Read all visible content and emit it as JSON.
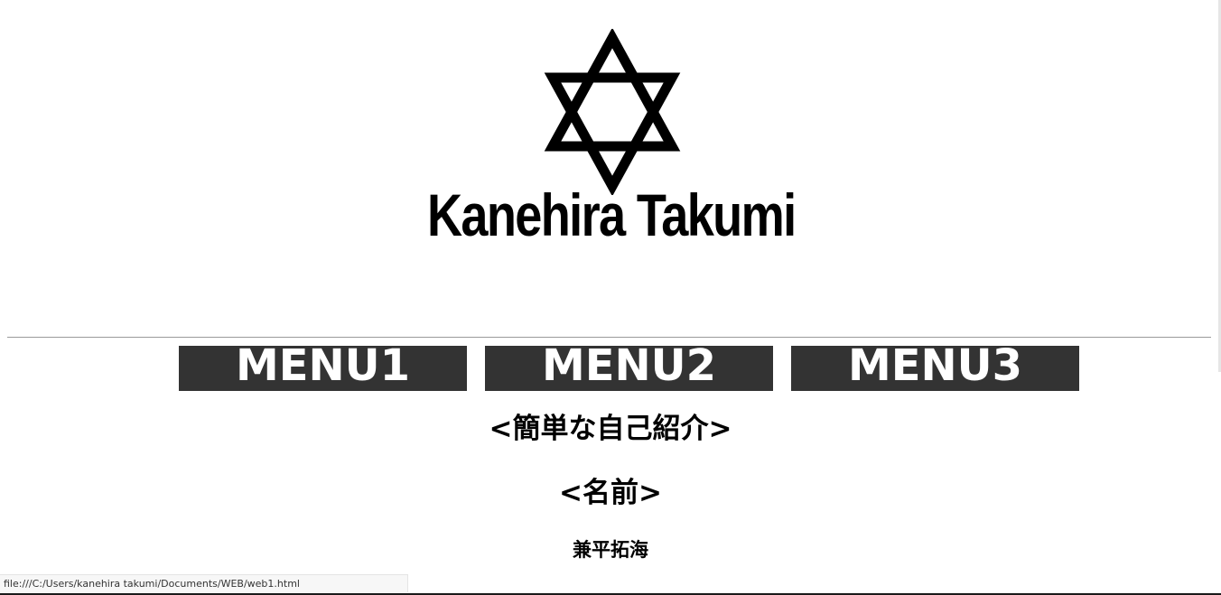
{
  "logo": {
    "text": "Kanehira Takumi",
    "icon": "hexagram-icon"
  },
  "nav": {
    "items": [
      {
        "label": "MENU1"
      },
      {
        "label": "MENU2"
      },
      {
        "label": "MENU3"
      }
    ],
    "background": "#333333",
    "text_color": "#ffffff"
  },
  "content": {
    "intro_heading": "<簡単な自己紹介>",
    "name_heading": "<名前>",
    "name_value": "兼平拓海"
  },
  "status_bar": {
    "url": "file:///C:/Users/kanehira takumi/Documents/WEB/web1.html"
  }
}
